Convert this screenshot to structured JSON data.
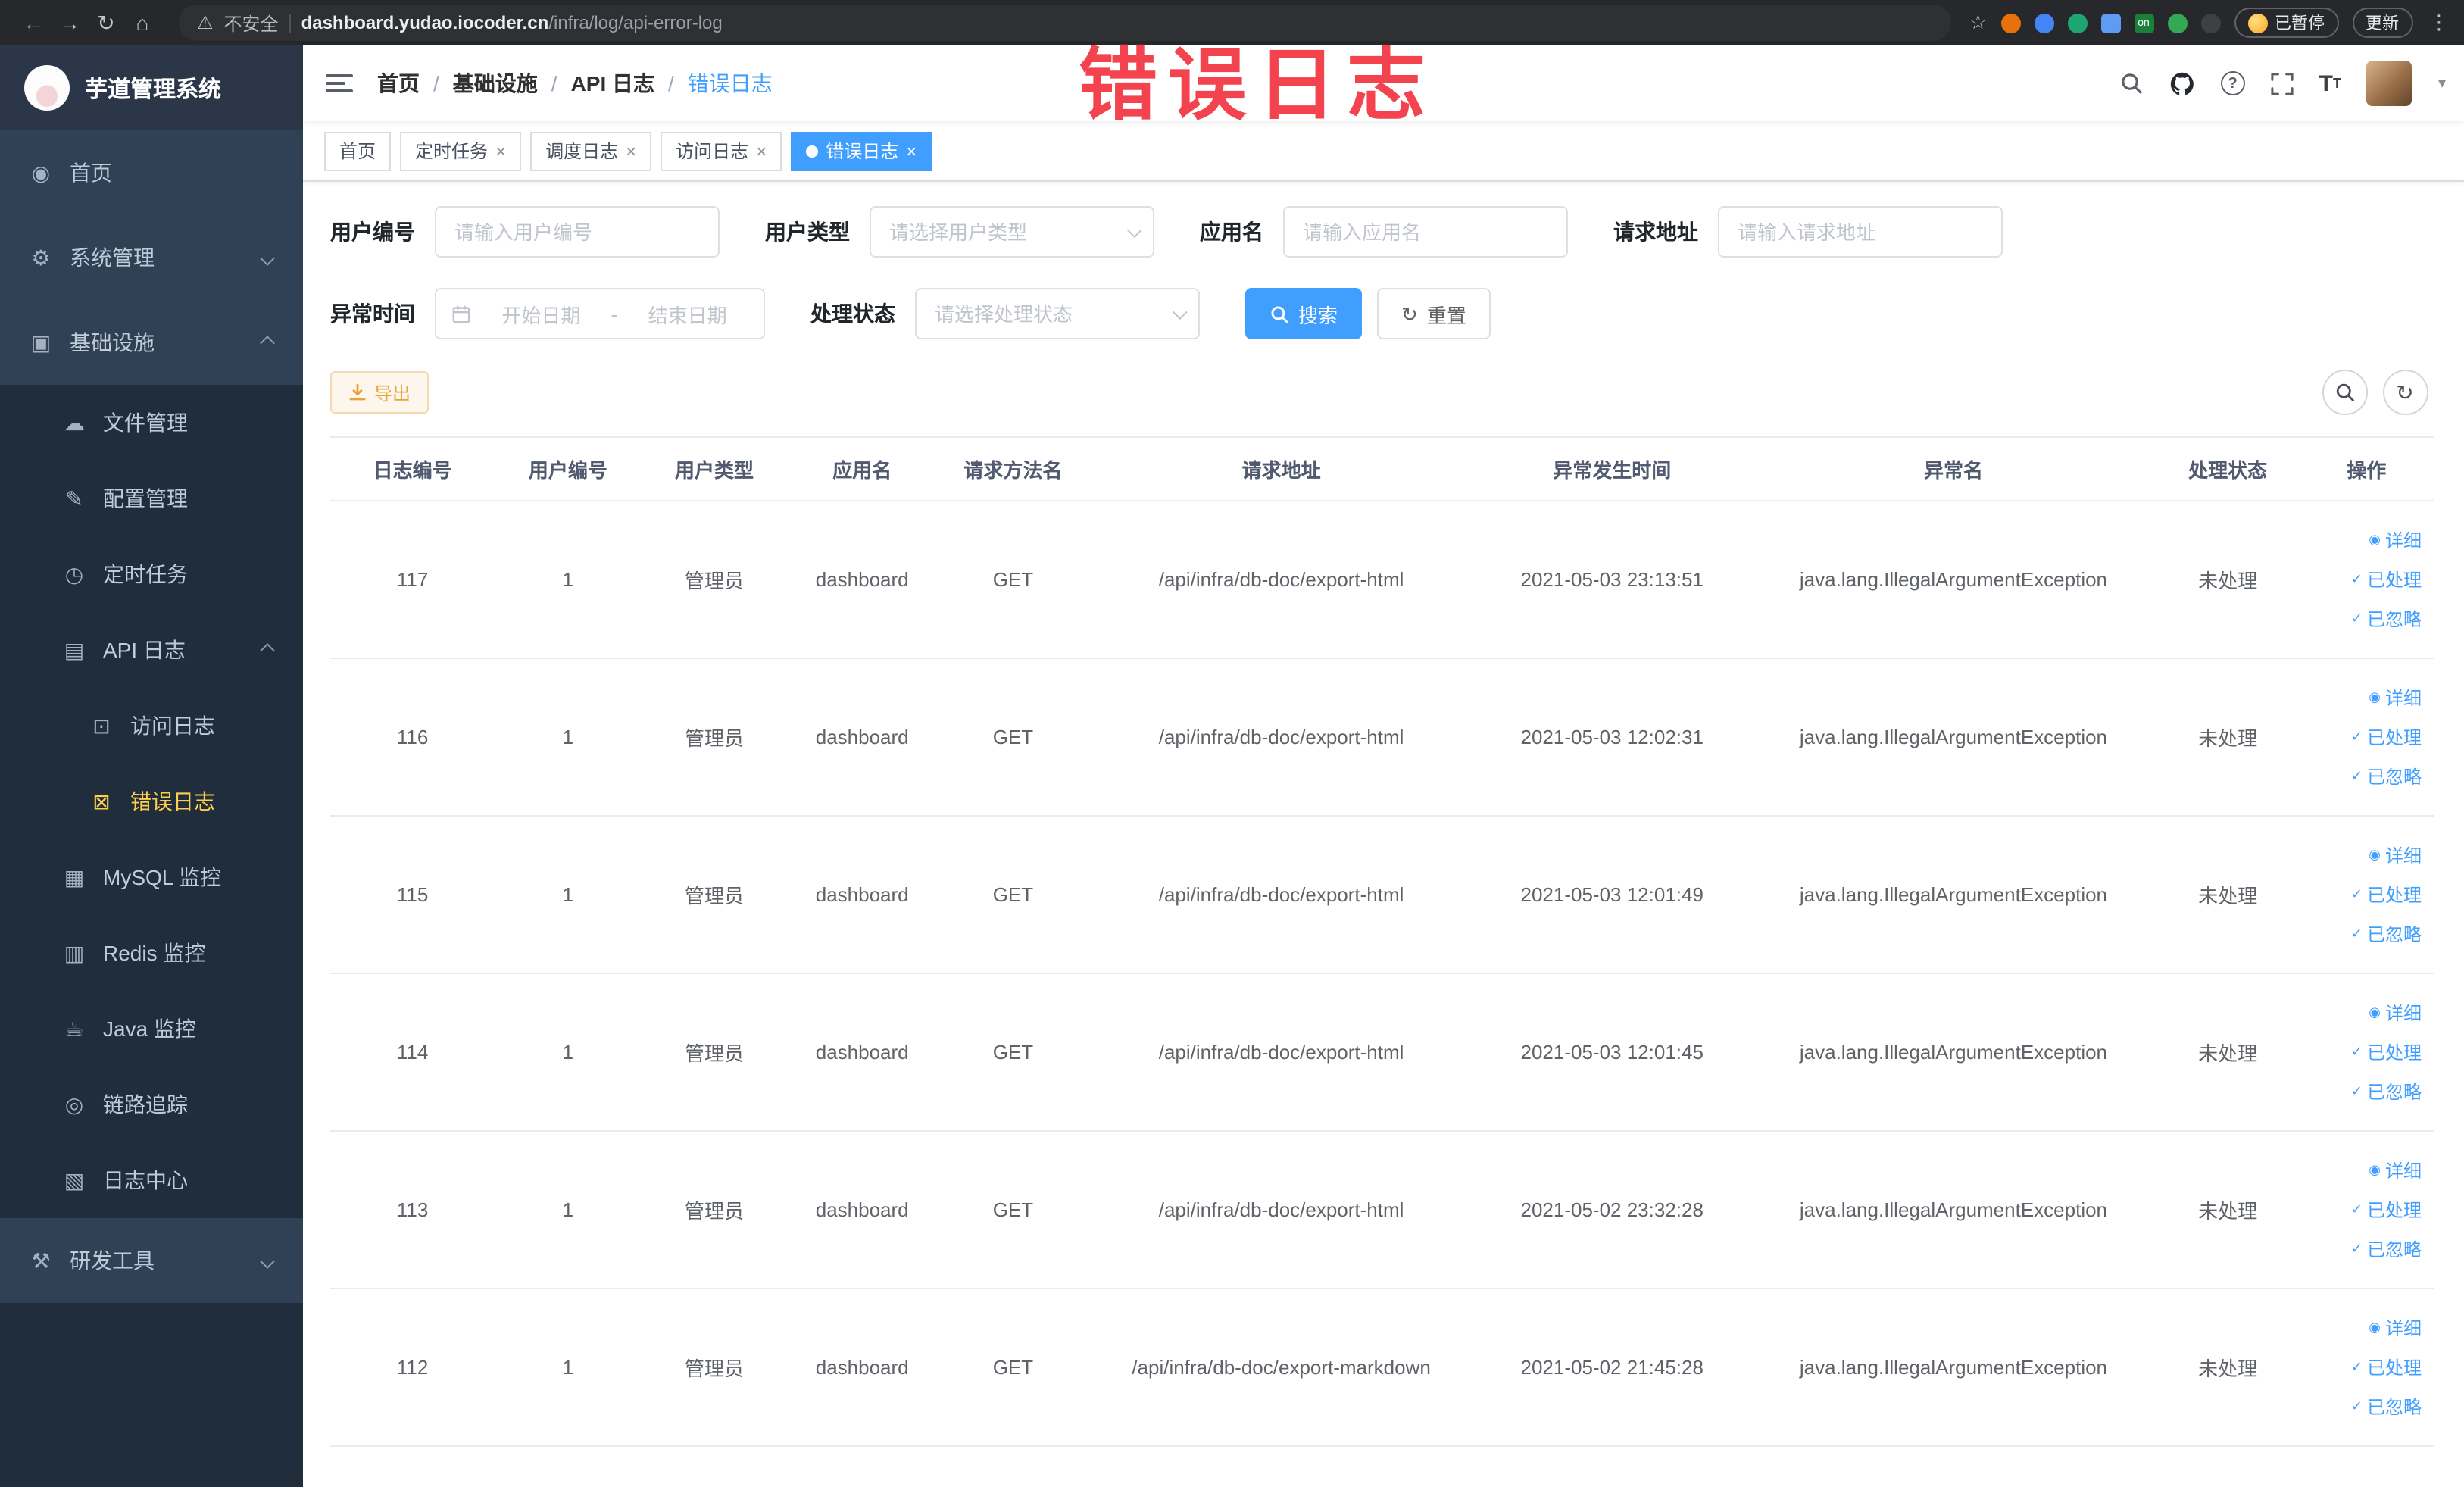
{
  "browser": {
    "security_text": "不安全",
    "url_domain": "dashboard.yudao.iocoder.cn",
    "url_path": "/infra/log/api-error-log",
    "ext_on_label": "on",
    "paused_label": "已暂停",
    "update_label": "更新"
  },
  "sidebar": {
    "app_title": "芋道管理系统",
    "menu": [
      {
        "label": "首页"
      },
      {
        "label": "系统管理"
      },
      {
        "label": "基础设施"
      },
      {
        "label": "文件管理"
      },
      {
        "label": "配置管理"
      },
      {
        "label": "定时任务"
      },
      {
        "label": "API 日志"
      },
      {
        "label": "访问日志"
      },
      {
        "label": "错误日志"
      },
      {
        "label": "MySQL 监控"
      },
      {
        "label": "Redis 监控"
      },
      {
        "label": "Java 监控"
      },
      {
        "label": "链路追踪"
      },
      {
        "label": "日志中心"
      },
      {
        "label": "研发工具"
      }
    ]
  },
  "header": {
    "breadcrumb": [
      "首页",
      "基础设施",
      "API 日志",
      "错误日志"
    ],
    "separator": "/"
  },
  "watermark": {
    "text": "错误日志"
  },
  "tabs": [
    {
      "label": "首页"
    },
    {
      "label": "定时任务"
    },
    {
      "label": "调度日志"
    },
    {
      "label": "访问日志"
    },
    {
      "label": "错误日志"
    }
  ],
  "filters": {
    "user_id_label": "用户编号",
    "user_id_placeholder": "请输入用户编号",
    "user_type_label": "用户类型",
    "user_type_placeholder": "请选择用户类型",
    "app_name_label": "应用名",
    "app_name_placeholder": "请输入应用名",
    "request_url_label": "请求地址",
    "request_url_placeholder": "请输入请求地址",
    "exception_time_label": "异常时间",
    "start_date_placeholder": "开始日期",
    "range_separator": "-",
    "end_date_placeholder": "结束日期",
    "process_status_label": "处理状态",
    "process_status_placeholder": "请选择处理状态",
    "search_button": "搜索",
    "reset_button": "重置"
  },
  "toolbar": {
    "export_button": "导出"
  },
  "table": {
    "columns": [
      "日志编号",
      "用户编号",
      "用户类型",
      "应用名",
      "请求方法名",
      "请求地址",
      "异常发生时间",
      "异常名",
      "处理状态",
      "操作"
    ],
    "actions": {
      "detail": "详细",
      "processed": "已处理",
      "ignored": "已忽略"
    },
    "rows": [
      {
        "log_id": "117",
        "user_id": "1",
        "user_type": "管理员",
        "app_name": "dashboard",
        "method": "GET",
        "url": "/api/infra/db-doc/export-html",
        "time": "2021-05-03 23:13:51",
        "exception": "java.lang.IllegalArgumentException",
        "status": "未处理"
      },
      {
        "log_id": "116",
        "user_id": "1",
        "user_type": "管理员",
        "app_name": "dashboard",
        "method": "GET",
        "url": "/api/infra/db-doc/export-html",
        "time": "2021-05-03 12:02:31",
        "exception": "java.lang.IllegalArgumentException",
        "status": "未处理"
      },
      {
        "log_id": "115",
        "user_id": "1",
        "user_type": "管理员",
        "app_name": "dashboard",
        "method": "GET",
        "url": "/api/infra/db-doc/export-html",
        "time": "2021-05-03 12:01:49",
        "exception": "java.lang.IllegalArgumentException",
        "status": "未处理"
      },
      {
        "log_id": "114",
        "user_id": "1",
        "user_type": "管理员",
        "app_name": "dashboard",
        "method": "GET",
        "url": "/api/infra/db-doc/export-html",
        "time": "2021-05-03 12:01:45",
        "exception": "java.lang.IllegalArgumentException",
        "status": "未处理"
      },
      {
        "log_id": "113",
        "user_id": "1",
        "user_type": "管理员",
        "app_name": "dashboard",
        "method": "GET",
        "url": "/api/infra/db-doc/export-html",
        "time": "2021-05-02 23:32:28",
        "exception": "java.lang.IllegalArgumentException",
        "status": "未处理"
      },
      {
        "log_id": "112",
        "user_id": "1",
        "user_type": "管理员",
        "app_name": "dashboard",
        "method": "GET",
        "url": "/api/infra/db-doc/export-markdown",
        "time": "2021-05-02 21:45:28",
        "exception": "java.lang.IllegalArgumentException",
        "status": "未处理"
      }
    ]
  },
  "colors": {
    "primary": "#409eff",
    "sidebar_bg": "#304156",
    "sidebar_sub_bg": "#1f2d3d",
    "sidebar_active_text": "#ffd04b",
    "warning": "#e6a23c",
    "annotation": "#f2434e"
  }
}
